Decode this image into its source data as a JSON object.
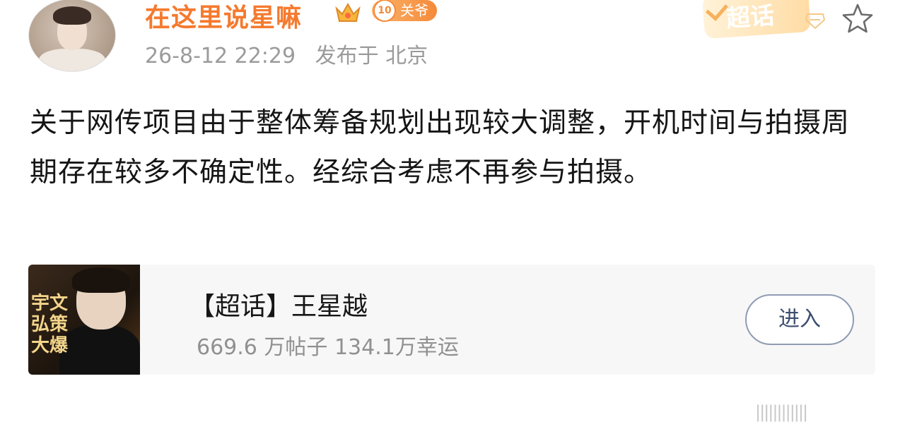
{
  "author": {
    "name": "在这里说星嘛",
    "fan_badge_level": "10",
    "fan_badge_label": "关爷"
  },
  "post": {
    "time": "26-8-12 22:29",
    "location": "发布于 北京",
    "text": "关于网传项目由于整体筹备规划出现较大调整，开机时间与拍摄周期存在较多不确定性。经综合考虑不再参与拍摄。"
  },
  "header_tag": {
    "label": "超话"
  },
  "topic_card": {
    "thumb_text": "宇文弘策大爆",
    "title": "【超话】王星越",
    "stats": "669.6 万帖子 134.1万幸运",
    "enter_label": "进入"
  },
  "watermark": "||||||||||||",
  "colors": {
    "username": "#f57a2e",
    "meta": "#9b9b9b",
    "button_border": "#8f9bb3"
  },
  "icons": [
    "crown-icon",
    "diamond-icon",
    "star-icon"
  ]
}
